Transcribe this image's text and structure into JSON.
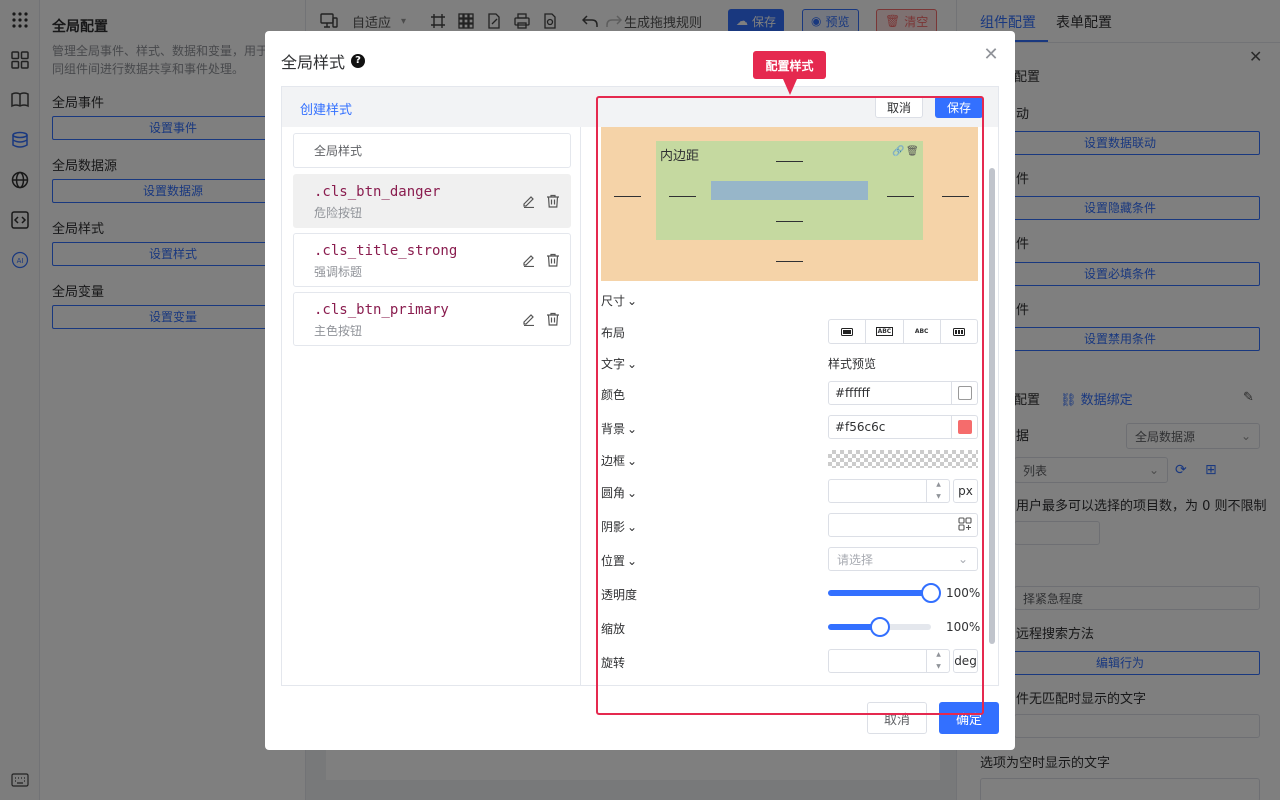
{
  "left_panel": {
    "title": "全局配置",
    "desc_line1": "管理全局事件、样式、数据和变量，用于",
    "desc_line2": "同组件间进行数据共享和事件处理。",
    "sections": [
      {
        "label": "全局事件",
        "button": "设置事件"
      },
      {
        "label": "全局数据源",
        "button": "设置数据源"
      },
      {
        "label": "全局样式",
        "button": "设置样式"
      },
      {
        "label": "全局变量",
        "button": "设置变量"
      }
    ]
  },
  "toolbar": {
    "adaptive": "自适应",
    "gen_rules": "生成拖拽规则",
    "save": "保存",
    "preview": "预览",
    "clear": "清空"
  },
  "right_panel": {
    "tabs": [
      "组件配置",
      "表单配置"
    ],
    "frag1": "配置",
    "frag2": "动",
    "btn_linkage": "设置数据联动",
    "frag3": "件",
    "btn_hide": "设置隐藏条件",
    "frag4": "件",
    "btn_required": "设置必填条件",
    "frag5": "件",
    "btn_disable": "设置禁用条件",
    "data_config": "配置",
    "data_bind": "数据绑定",
    "frag_data": "据",
    "datasource": "全局数据源",
    "list": "列表",
    "max_select": "用户最多可以选择的项目数，为 0 则不限制",
    "urgency": "择紧急程度",
    "remote_search": "远程搜索方法",
    "btn_edit_behavior": "编辑行为",
    "no_match": "件无匹配时显示的文字",
    "empty_text": "选项为空时显示的文字"
  },
  "dialog": {
    "title": "全局样式",
    "create_style": "创建样式",
    "search_placeholder": "全局样式",
    "styles": [
      {
        "name": ".cls_btn_danger",
        "desc": "危险按钮"
      },
      {
        "name": ".cls_title_strong",
        "desc": "强调标题"
      },
      {
        "name": ".cls_btn_primary",
        "desc": "主色按钮"
      }
    ],
    "editor_cancel": "取消",
    "editor_save": "保存",
    "callout": "配置样式",
    "box_model": {
      "label": "内边距",
      "dash": "——"
    },
    "fields": {
      "size": "尺寸",
      "layout": "布局",
      "text": "文字",
      "preview": "样式预览",
      "color": "颜色",
      "color_value": "#ffffff",
      "background": "背景",
      "background_value": "#f56c6c",
      "border": "边框",
      "radius": "圆角",
      "radius_unit": "px",
      "shadow": "阴影",
      "position": "位置",
      "position_placeholder": "请选择",
      "opacity": "透明度",
      "opacity_value": "100%",
      "scale": "缩放",
      "scale_value": "100%",
      "rotate": "旋转",
      "rotate_unit": "deg"
    },
    "layout_options": [
      "",
      "ABC",
      "ABC",
      ""
    ],
    "slider_levels": {
      "opacity": 1.0,
      "scale": 0.5
    },
    "cancel": "取消",
    "confirm": "确定"
  },
  "colors": {
    "primary": "#3370ff",
    "danger": "#f56c6c",
    "callout": "#e5294f",
    "padding_box": "#c5d9a0",
    "margin_box": "#f5d3a8",
    "content_box": "#97b6c9"
  }
}
